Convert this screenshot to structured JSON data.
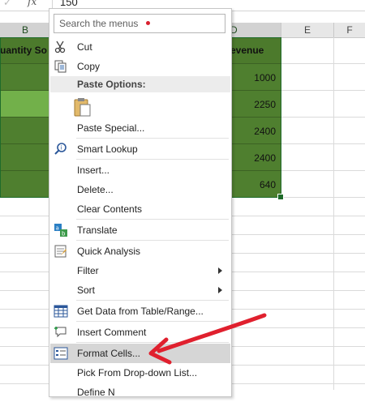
{
  "formula_bar": {
    "fx": "fx",
    "value": "150"
  },
  "columns": [
    {
      "letter": "B"
    },
    {
      "letter": "D"
    },
    {
      "letter": "E"
    },
    {
      "letter": "F"
    }
  ],
  "table": {
    "header_b": "uantity So",
    "header_d": "evenue",
    "revenue": [
      "1000",
      "2250",
      "2400",
      "2400",
      "640"
    ]
  },
  "menu": {
    "search_placeholder": "Search the menus",
    "items": {
      "cut": "Cut",
      "copy": "Copy",
      "paste_options": "Paste Options:",
      "paste_special": "Paste Special...",
      "smart_lookup": "Smart Lookup",
      "insert": "Insert...",
      "delete": "Delete...",
      "clear_contents": "Clear Contents",
      "translate": "Translate",
      "quick_analysis": "Quick Analysis",
      "filter": "Filter",
      "sort": "Sort",
      "get_data": "Get Data from Table/Range...",
      "insert_comment": "Insert Comment",
      "format_cells": "Format Cells...",
      "pick_dropdown": "Pick From Drop-down List...",
      "define_name": "Define N"
    }
  },
  "colors": {
    "accent_green": "#4f7f2f",
    "light_green": "#72b04a",
    "arrow_red": "#e0202e"
  }
}
